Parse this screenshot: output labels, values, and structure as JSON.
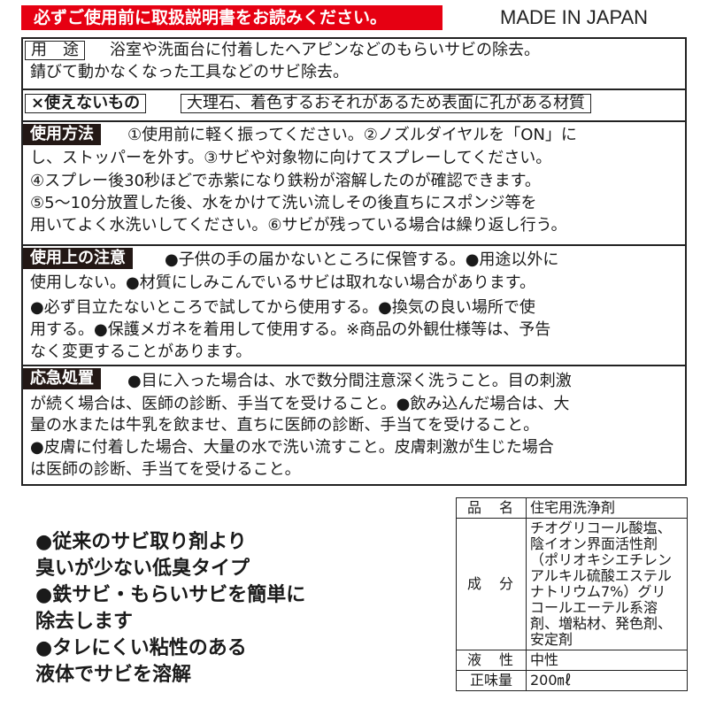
{
  "header": {
    "warning_banner": "必ずご使用前に取扱説明書をお読みください。",
    "origin": "MADE IN JAPAN"
  },
  "usage": {
    "label": "用　途",
    "line1": "浴室や洗面台に付着したヘアピンなどのもらいサビの除去。",
    "line2": "錆びて動かなくなった工具などのサビ除去。"
  },
  "not_usable": {
    "label": "×使えないもの",
    "text": "大理石、着色するおそれがあるため表面に孔がある材質"
  },
  "how_to_use": {
    "label": "使用方法",
    "lines": [
      "①使用前に軽く振ってください。②ノズルダイヤルを「ON」に",
      "し、ストッパーを外す。③サビや対象物に向けてスプレーしてください。",
      "④スプレー後30秒ほどで赤紫になり鉄粉が溶解したのが確認できます。",
      "⑤5～10分放置した後、水をかけて洗い流しその後直ちにスポンジ等を",
      "用いてよく水洗いしてください。⑥サビが残っている場合は繰り返し行う。"
    ]
  },
  "precautions": {
    "label": "使用上の注意",
    "lines": [
      "●子供の手の届かないところに保管する。●用途以外に",
      "使用しない。●材質にしみこんでいるサビは取れない場合があります。",
      "●必ず目立たないところで試してから使用する。●換気の良い場所で使",
      "用する。●保護メガネを着用して使用する。※商品の外観仕様等は、予告",
      "なく変更することがあります。"
    ]
  },
  "first_aid": {
    "label": "応急処置",
    "lines": [
      "●目に入った場合は、水で数分間注意深く洗うこと。目の刺激",
      "が続く場合は、医師の診断、手当てを受けること。●飲み込んだ場合は、大",
      "量の水または牛乳を飲ませ、直ちに医師の診断、手当てを受けること。",
      "●皮膚に付着した場合、大量の水で洗い流すこと。皮膚刺激が生じた場合",
      "は医師の診断、手当てを受けること。"
    ]
  },
  "features": [
    "●従来のサビ取り剤より",
    "臭いが少ない低臭タイプ",
    "●鉄サビ・もらいサビを簡単に",
    "除去します",
    "●タレにくい粘性のある",
    "液体でサビを溶解"
  ],
  "spec_table": {
    "product_label": "品　名",
    "product_value": "住宅用洗浄剤",
    "ingredients_label": "成　分",
    "ingredients_lines": [
      "チオグリコール酸塩、",
      "陰イオン界面活性剤",
      "（ポリオキシエチレン",
      "アルキル硫酸エステル",
      "ナトリウム7%）グリ",
      "コールエーテル系溶",
      "剤、増粘材、発色剤、",
      "安定剤"
    ],
    "liquid_label": "液　性",
    "liquid_value": "中性",
    "volume_label": "正味量",
    "volume_value": "200㎖"
  }
}
